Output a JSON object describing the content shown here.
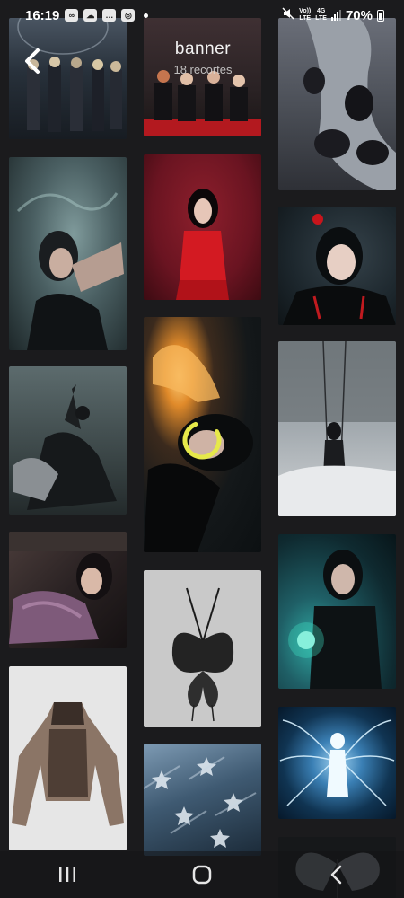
{
  "status_bar": {
    "time": "16:19",
    "network_top": "Vo))",
    "network_bottom": "LTE",
    "network_type_top": "4G",
    "network_type_bottom": "LTE",
    "battery": "70%"
  },
  "header": {
    "title": "banner",
    "pin_count": "18 recortes"
  },
  "loading": true,
  "colors": {
    "background": "#1b1b1d",
    "spinner": "#e6e94a"
  },
  "pins": [
    {
      "name": "pin-group-stage-photo",
      "icon": "photo"
    },
    {
      "name": "pin-group-red-carpet",
      "icon": "photo"
    },
    {
      "name": "pin-slide-group",
      "icon": "photo"
    },
    {
      "name": "pin-portrait-water",
      "icon": "photo"
    },
    {
      "name": "pin-portrait-red-outfit",
      "icon": "photo"
    },
    {
      "name": "pin-portrait-red-rose",
      "icon": "photo"
    },
    {
      "name": "pin-fire-portrait",
      "icon": "photo"
    },
    {
      "name": "pin-swing-portrait",
      "icon": "photo"
    },
    {
      "name": "pin-pose-dark",
      "icon": "photo"
    },
    {
      "name": "pin-car-portrait",
      "icon": "photo"
    },
    {
      "name": "pin-glow-portrait",
      "icon": "photo"
    },
    {
      "name": "pin-butterfly-top",
      "icon": "photo"
    },
    {
      "name": "pin-jacket-product",
      "icon": "photo"
    },
    {
      "name": "pin-fairy-glow",
      "icon": "photo"
    },
    {
      "name": "pin-stars-texture",
      "icon": "photo"
    },
    {
      "name": "pin-butterfly-wings",
      "icon": "photo"
    }
  ],
  "nav": {
    "recents": "recents-icon",
    "home": "home-icon",
    "back": "back-icon"
  }
}
